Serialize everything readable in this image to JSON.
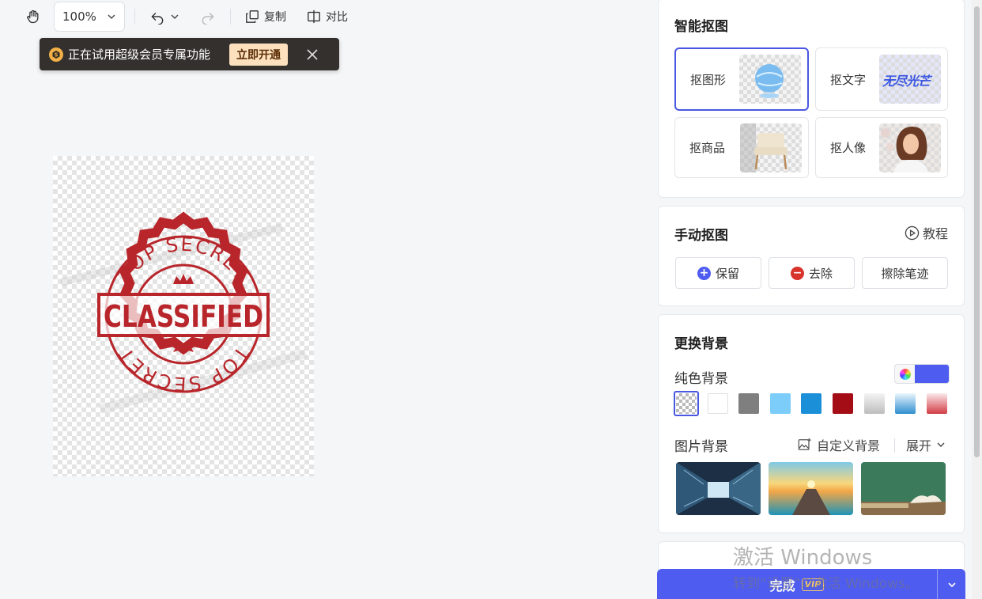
{
  "toolbar": {
    "zoom_value": "100",
    "zoom_unit": "%",
    "copy_label": "复制",
    "compare_label": "对比"
  },
  "banner": {
    "text": "正在试用超级会员专属功能",
    "open_label": "立即开通"
  },
  "stamp": {
    "top_text": "TOP SECRET",
    "main_text": "CLASSIFIED",
    "bottom_text": "TOP SECRET",
    "color": "#b8262b"
  },
  "smart_cutout": {
    "title": "智能抠图",
    "items": [
      {
        "label": "抠图形"
      },
      {
        "label": "抠文字",
        "thumb_text": "无尽光芒"
      },
      {
        "label": "抠商品"
      },
      {
        "label": "抠人像"
      }
    ]
  },
  "manual_cutout": {
    "title": "手动抠图",
    "tutorial_label": "教程",
    "keep_label": "保留",
    "remove_label": "去除",
    "erase_label": "擦除笔迹"
  },
  "background": {
    "title": "更换背景",
    "solid_label": "纯色背景",
    "picker_color": "#4e5cf0",
    "colors": [
      "transparent",
      "#ffffff",
      "#7f7f7f",
      "#7dcdfb",
      "#1b8fd8",
      "#a40d15",
      "gradient-gray",
      "gradient-blue",
      "gradient-red"
    ],
    "image_label": "图片背景",
    "custom_label": "自定义背景",
    "expand_label": "展开"
  },
  "finish": {
    "label": "完成",
    "vip": "VIP"
  },
  "watermark": {
    "line1": "激活 Windows",
    "line2": "转到“设置”以激活 Windows。"
  },
  "colors": {
    "accent": "#4e5cf0",
    "active_border": "#4a57e0"
  }
}
